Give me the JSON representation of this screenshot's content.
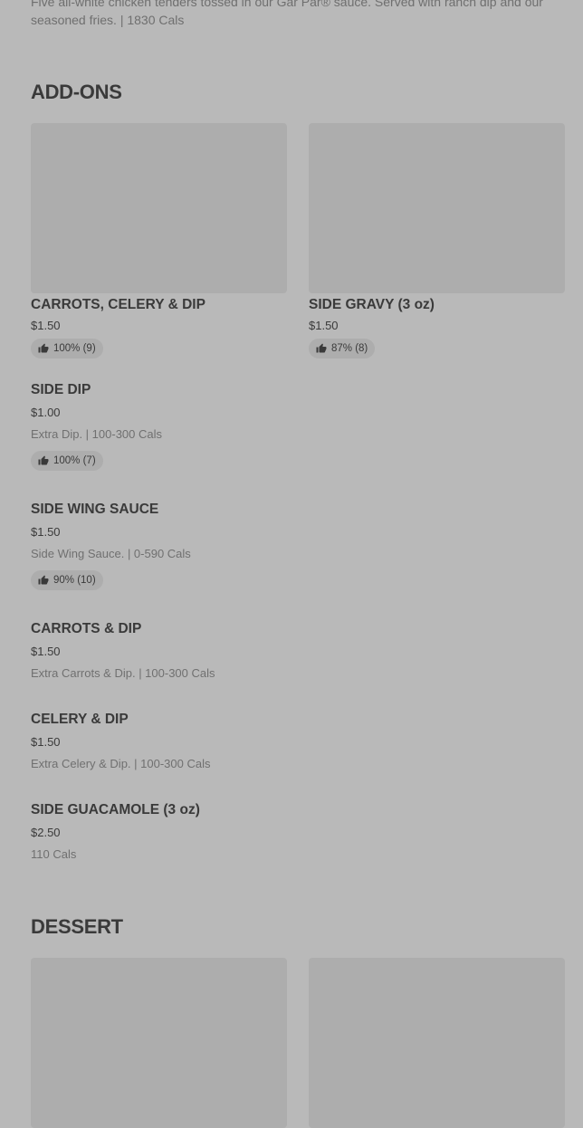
{
  "previous_item": {
    "description": "Five all-white chicken tenders tossed in our Gar Par® sauce. Served with ranch dip and our seasoned fries. | 1830 Cals"
  },
  "addons": {
    "title": "ADD-ONS",
    "cards": [
      {
        "name": "CARROTS, CELERY & DIP",
        "price": "$1.50",
        "rating": "100% (9)"
      },
      {
        "name": "SIDE GRAVY (3 oz)",
        "price": "$1.50",
        "rating": "87% (8)"
      }
    ],
    "items": [
      {
        "name": "SIDE DIP",
        "price": "$1.00",
        "description": "Extra Dip. | 100-300 Cals",
        "rating": "100% (7)"
      },
      {
        "name": "SIDE WING SAUCE",
        "price": "$1.50",
        "description": "Side Wing Sauce. | 0-590 Cals",
        "rating": "90% (10)"
      },
      {
        "name": "CARROTS & DIP",
        "price": "$1.50",
        "description": "Extra Carrots & Dip. | 100-300 Cals"
      },
      {
        "name": "CELERY & DIP",
        "price": "$1.50",
        "description": "Extra Celery & Dip. | 100-300 Cals"
      },
      {
        "name": "SIDE GUACAMOLE (3 oz)",
        "price": "$2.50",
        "description": "110 Cals"
      }
    ]
  },
  "dessert": {
    "title": "DESSERT"
  },
  "icons": {
    "thumbs_up": "thumbs-up-icon"
  },
  "colors": {
    "background": "#b9b9b9",
    "placeholder": "#adadad",
    "text": "#3a3a3a",
    "muted_text": "#707070"
  }
}
